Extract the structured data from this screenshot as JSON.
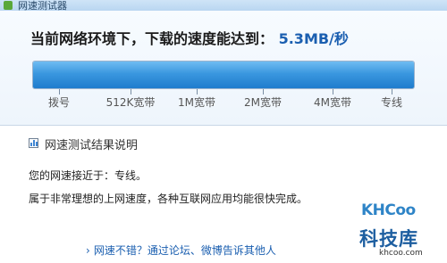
{
  "window": {
    "title": "网速测试器"
  },
  "speed_text": {
    "prefix": "当前网络环境下，下载的速度能达到：",
    "value": "5.3MB/秒"
  },
  "progress": {
    "fraction": 1.0,
    "color": "#3a97df"
  },
  "scale_labels": [
    "拨号",
    "512K宽带",
    "1M宽带",
    "2M宽带",
    "4M宽带",
    "专线"
  ],
  "result": {
    "header": "网速测试结果说明",
    "line1": "您的网速接近于：专线。",
    "line2": "属于非常理想的上网速度，各种互联网应用均能很快完成。"
  },
  "share": {
    "label": "网速不错？通过论坛、微博告诉其他人"
  },
  "watermark": {
    "brand": "KHCoo",
    "name": "科技库",
    "url": "khcoo.com"
  },
  "colors": {
    "accent": "#1b5fb0",
    "bar": "#3a97df"
  }
}
